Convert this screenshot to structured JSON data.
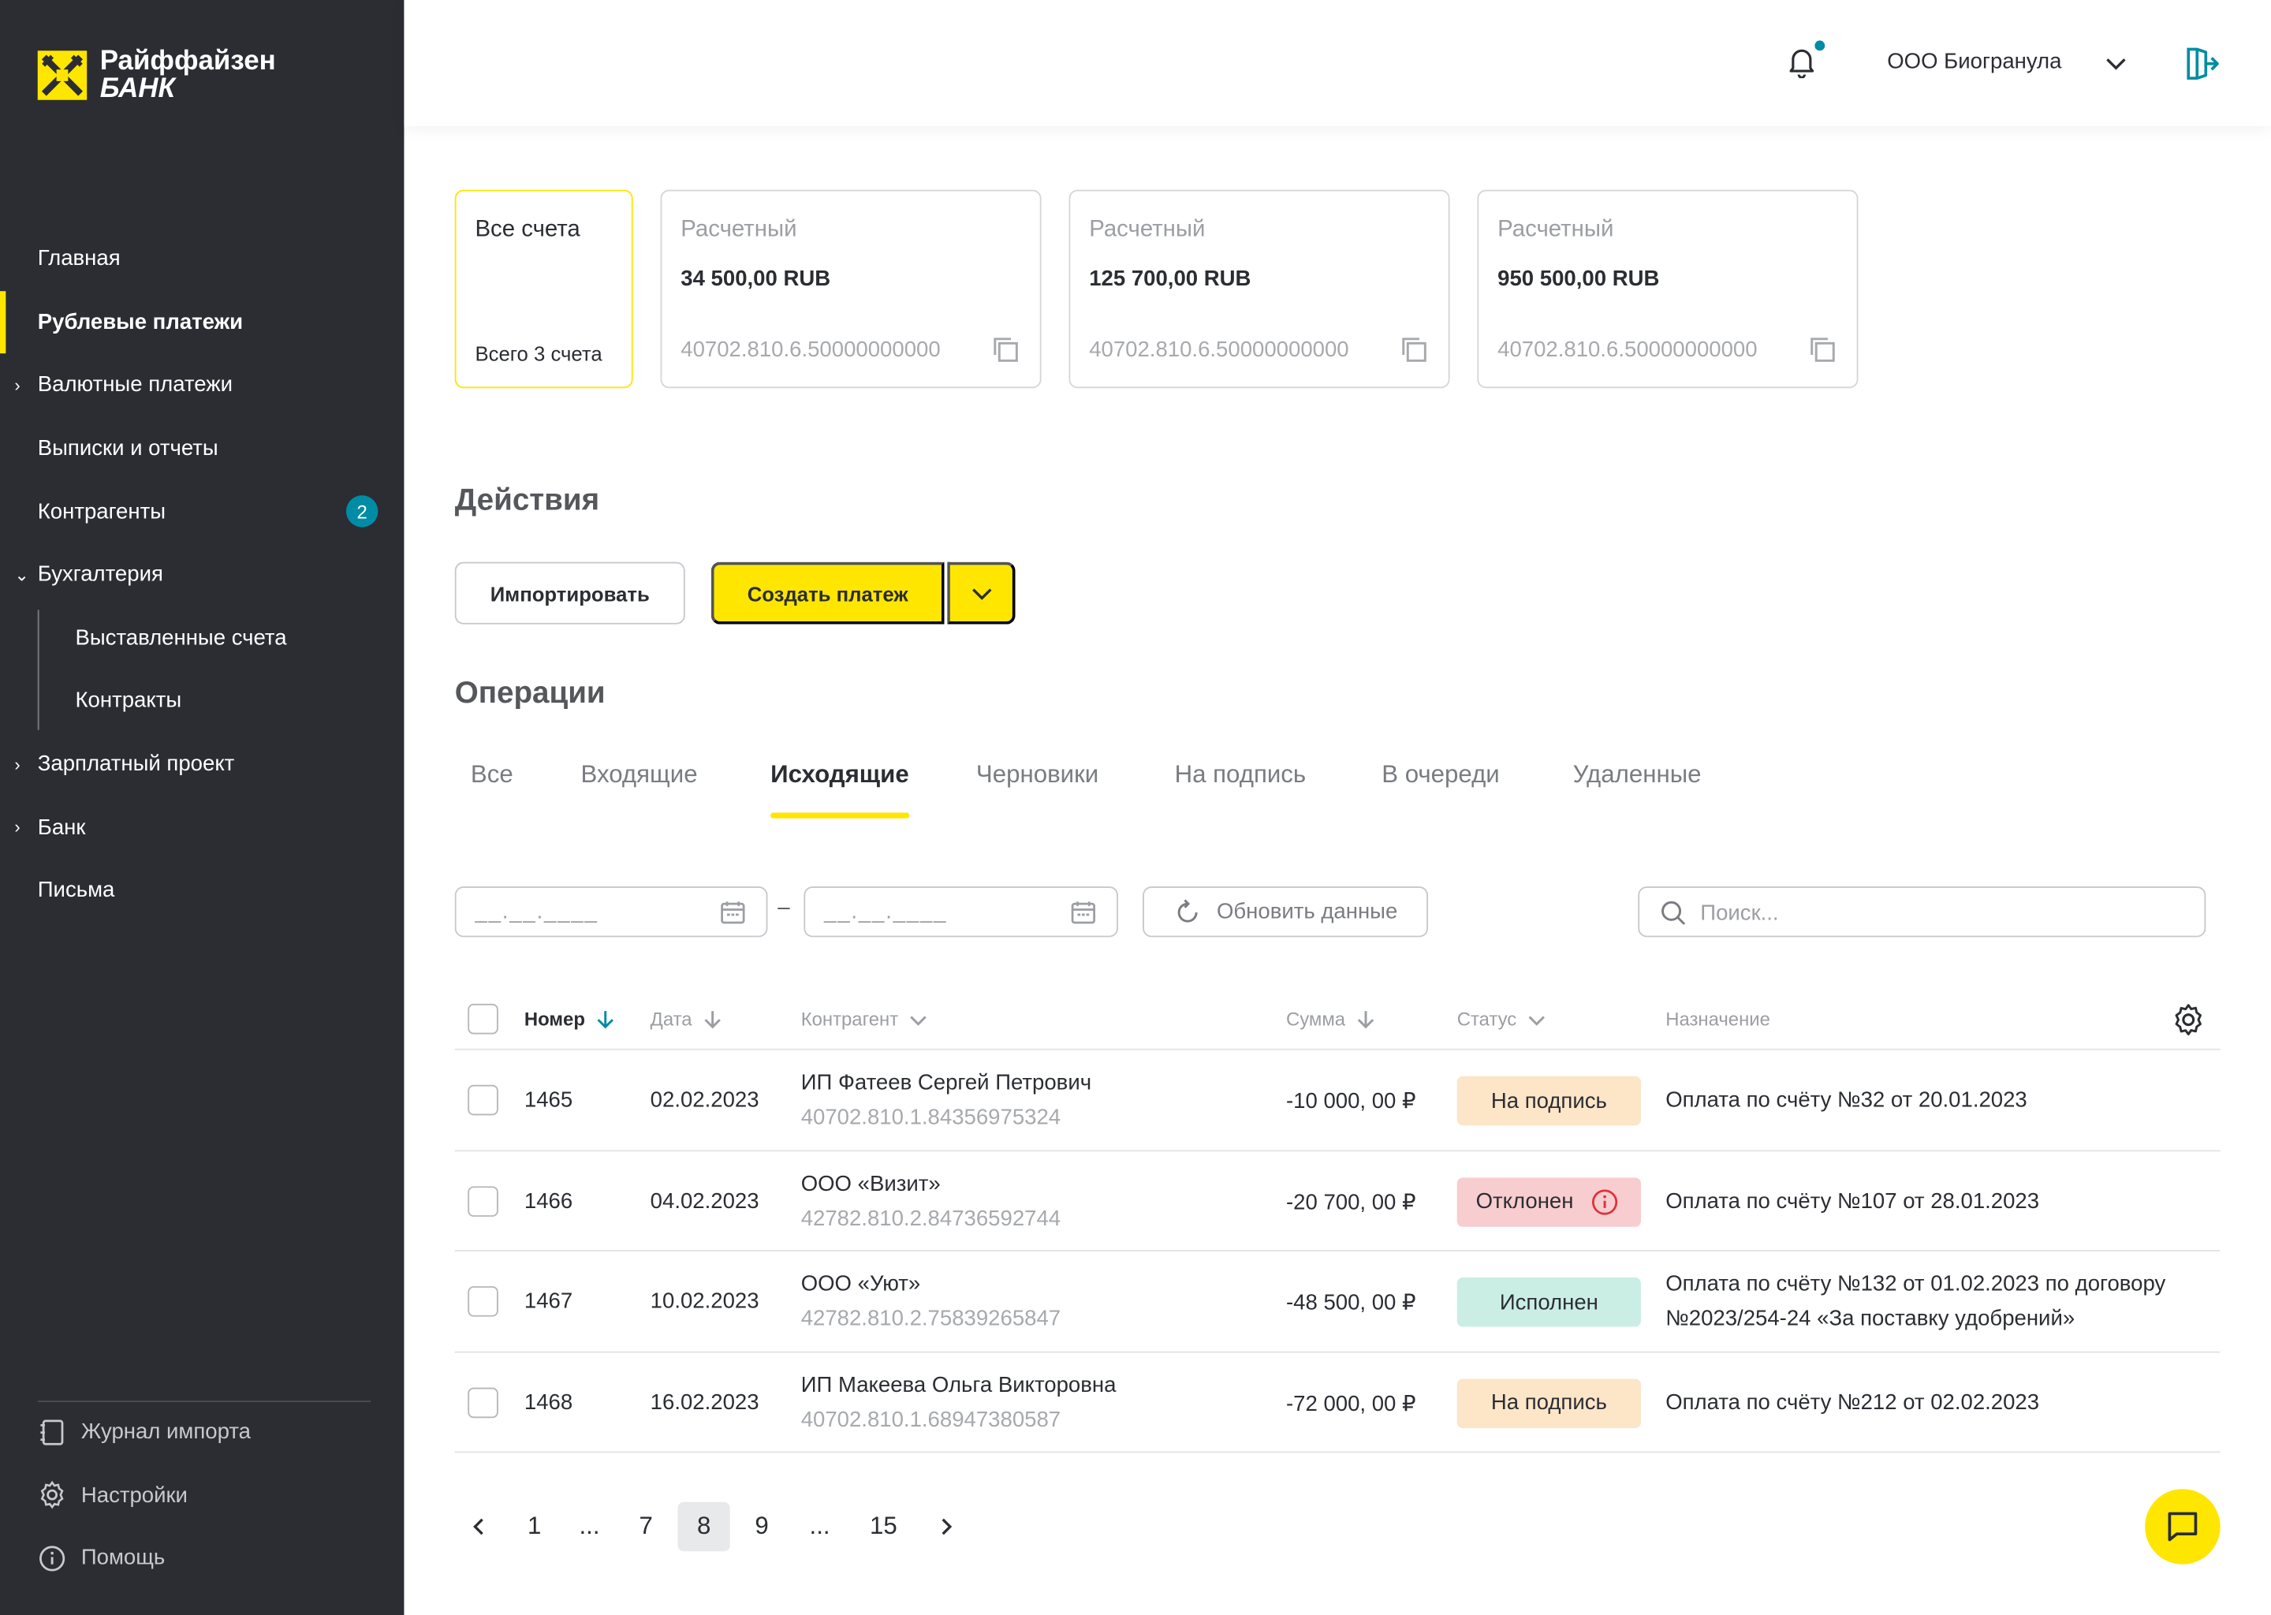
{
  "brand": {
    "line1": "Райффайзен",
    "line2": "БАНК",
    "accent": "#fee600",
    "dark": "#2b2d33"
  },
  "sidebar": {
    "items": [
      {
        "label": "Главная"
      },
      {
        "label": "Рублевые платежи"
      },
      {
        "label": "Валютные платежи"
      },
      {
        "label": "Выписки и отчеты"
      },
      {
        "label": "Контрагенты",
        "badge": "2"
      },
      {
        "label": "Бухгалтерия"
      },
      {
        "label": "Выставленные счета"
      },
      {
        "label": "Контракты"
      },
      {
        "label": "Зарплатный проект"
      },
      {
        "label": "Банк"
      },
      {
        "label": "Письма"
      }
    ],
    "bottom": [
      {
        "label": "Журнал импорта",
        "icon": "import-log-icon"
      },
      {
        "label": "Настройки",
        "icon": "gear-icon"
      },
      {
        "label": "Помощь",
        "icon": "info-icon"
      }
    ]
  },
  "header": {
    "company": "ООО Биогранула"
  },
  "accounts": [
    {
      "title": "Все счета",
      "footer": "Всего 3 счета"
    },
    {
      "title": "Расчетный",
      "amount": "34 500,00 RUB",
      "number": "40702.810.6.50000000000"
    },
    {
      "title": "Расчетный",
      "amount": "125 700,00 RUB",
      "number": "40702.810.6.50000000000"
    },
    {
      "title": "Расчетный",
      "amount": "950 500,00 RUB",
      "number": "40702.810.6.50000000000"
    }
  ],
  "actions": {
    "title": "Действия",
    "import": "Импортировать",
    "create": "Создать платеж"
  },
  "operations": {
    "title": "Операции",
    "tabs": [
      "Все",
      "Входящие",
      "Исходящие",
      "Черновики",
      "На подпись",
      "В очереди",
      "Удаленные"
    ],
    "active_tab": "Исходящие",
    "date_placeholder": "__.__.____",
    "refresh": "Обновить данные",
    "search_placeholder": "Поиск...",
    "columns": {
      "number": "Номер",
      "date": "Дата",
      "counterparty": "Контрагент",
      "amount": "Сумма",
      "status": "Статус",
      "purpose": "Назначение"
    },
    "rows": [
      {
        "number": "1465",
        "date": "02.02.2023",
        "name": "ИП Фатеев Сергей Петрович",
        "account": "40702.810.1.84356975324",
        "amount": "-10 000, 00 ₽",
        "status": "На подпись",
        "status_kind": "sign",
        "purpose1": "Оплата по счёту №32 от 20.01.2023",
        "purpose2": ""
      },
      {
        "number": "1466",
        "date": "04.02.2023",
        "name": "ООО «Визит»",
        "account": "42782.810.2.84736592744",
        "amount": "-20 700, 00 ₽",
        "status": "Отклонен",
        "status_kind": "rej",
        "purpose1": "Оплата по счёту №107 от 28.01.2023",
        "purpose2": ""
      },
      {
        "number": "1467",
        "date": "10.02.2023",
        "name": "ООО «Уют»",
        "account": "42782.810.2.75839265847",
        "amount": "-48 500, 00 ₽",
        "status": "Исполнен",
        "status_kind": "done",
        "purpose1": "Оплата по счёту №132 от 01.02.2023 по договору",
        "purpose2": "№2023/254-24 «За поставку удобрений»"
      },
      {
        "number": "1468",
        "date": "16.02.2023",
        "name": "ИП Макеева Ольга Викторовна",
        "account": "40702.810.1.68947380587",
        "amount": "-72 000, 00 ₽",
        "status": "На подпись",
        "status_kind": "sign",
        "purpose1": "Оплата по счёту №212 от 02.02.2023",
        "purpose2": ""
      }
    ]
  },
  "pagination": {
    "pages": [
      "1",
      "...",
      "7",
      "8",
      "9",
      "...",
      "15"
    ],
    "current": "8"
  }
}
